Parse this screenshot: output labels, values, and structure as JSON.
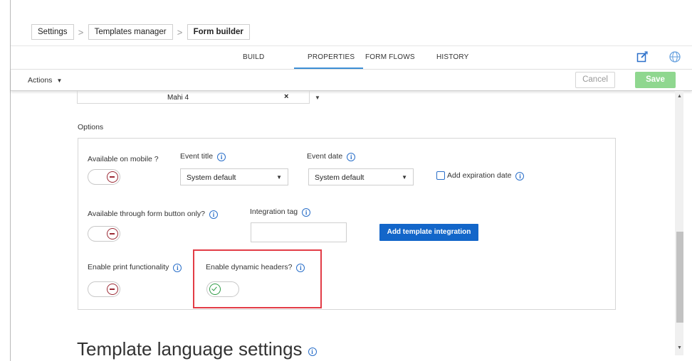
{
  "breadcrumb": [
    {
      "label": "Settings"
    },
    {
      "label": "Templates manager"
    },
    {
      "label": "Form builder"
    }
  ],
  "breadcrumb_separator": ">",
  "tabs": [
    {
      "label": "BUILD"
    },
    {
      "label": "PROPERTIES",
      "active": true
    },
    {
      "label": "FORM FLOWS"
    },
    {
      "label": "HISTORY"
    }
  ],
  "toolbar": {
    "actions_label": "Actions",
    "cancel_label": "Cancel",
    "save_label": "Save",
    "edit_icon": "edit-icon",
    "globe_icon": "globe-icon"
  },
  "language_row": {
    "value": "Mahi 4",
    "clear_symbol": "×"
  },
  "options": {
    "section_label": "Options",
    "available_on_mobile": {
      "label": "Available on mobile ?",
      "enabled": false
    },
    "event_title": {
      "label": "Event title",
      "value": "System default"
    },
    "event_date": {
      "label": "Event date",
      "value": "System default"
    },
    "add_expiration_date": {
      "label": "Add expiration date",
      "checked": false
    },
    "form_button_only": {
      "label": "Available through form button only?",
      "enabled": false
    },
    "integration_tag": {
      "label": "Integration tag",
      "value": ""
    },
    "add_integration_button": "Add template integration",
    "print_functionality": {
      "label": "Enable print functionality",
      "enabled": false
    },
    "dynamic_headers": {
      "label": "Enable dynamic headers?",
      "enabled": true
    }
  },
  "language_settings": {
    "title": "Template language settings"
  },
  "info_glyph": "i",
  "colors": {
    "accent": "#3d8fd6",
    "primary_button": "#1366c9",
    "save_button": "#8fd78f",
    "toggle_off": "#9b2a35",
    "toggle_on": "#2e9a45",
    "highlight": "#e23c46"
  }
}
